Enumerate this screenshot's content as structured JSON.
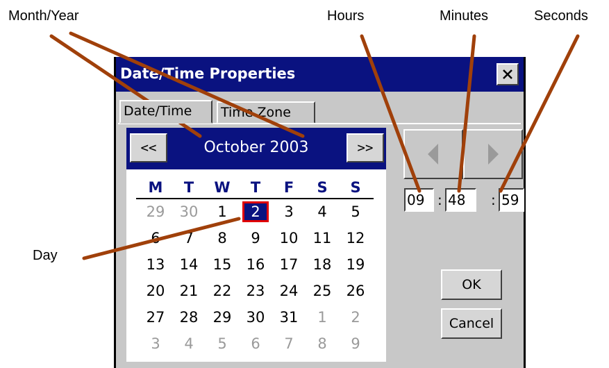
{
  "callouts": {
    "month_year": "Month/Year",
    "hours": "Hours",
    "minutes": "Minutes",
    "seconds": "Seconds",
    "day": "Day"
  },
  "dialog": {
    "title": "Date/Time Properties",
    "close_icon": "close-icon",
    "tabs": [
      {
        "label": "Date/Time",
        "active": true
      },
      {
        "label": "Time Zone",
        "active": false
      }
    ]
  },
  "calendar": {
    "prev_label": "<<",
    "next_label": ">>",
    "month_year": "October 2003",
    "days_of_week": [
      "M",
      "T",
      "W",
      "T",
      "F",
      "S",
      "S"
    ],
    "weeks": [
      [
        {
          "d": "29",
          "m": true
        },
        {
          "d": "30",
          "m": true
        },
        {
          "d": "1"
        },
        {
          "d": "2",
          "sel": true
        },
        {
          "d": "3"
        },
        {
          "d": "4"
        },
        {
          "d": "5"
        }
      ],
      [
        {
          "d": "6"
        },
        {
          "d": "7"
        },
        {
          "d": "8"
        },
        {
          "d": "9"
        },
        {
          "d": "10"
        },
        {
          "d": "11"
        },
        {
          "d": "12"
        }
      ],
      [
        {
          "d": "13"
        },
        {
          "d": "14"
        },
        {
          "d": "15"
        },
        {
          "d": "16"
        },
        {
          "d": "17"
        },
        {
          "d": "18"
        },
        {
          "d": "19"
        }
      ],
      [
        {
          "d": "20"
        },
        {
          "d": "21"
        },
        {
          "d": "22"
        },
        {
          "d": "23"
        },
        {
          "d": "24"
        },
        {
          "d": "25"
        },
        {
          "d": "26"
        }
      ],
      [
        {
          "d": "27"
        },
        {
          "d": "28"
        },
        {
          "d": "29"
        },
        {
          "d": "30"
        },
        {
          "d": "31"
        },
        {
          "d": "1",
          "m": true
        },
        {
          "d": "2",
          "m": true
        }
      ],
      [
        {
          "d": "3",
          "m": true
        },
        {
          "d": "4",
          "m": true
        },
        {
          "d": "5",
          "m": true
        },
        {
          "d": "6",
          "m": true
        },
        {
          "d": "7",
          "m": true
        },
        {
          "d": "8",
          "m": true
        },
        {
          "d": "9",
          "m": true
        }
      ]
    ]
  },
  "time": {
    "hours": "09",
    "minutes": "48",
    "seconds": "59",
    "separator": ":",
    "left_icon": "triangle-left-icon",
    "right_icon": "triangle-right-icon"
  },
  "buttons": {
    "ok": "OK",
    "cancel": "Cancel"
  },
  "colors": {
    "title_bar": "#0a1280",
    "dialog_face": "#c8c8c8",
    "selected_day_border": "#e00000",
    "leader_lines": "#a0400a",
    "muted_day": "#9a9a9a"
  }
}
